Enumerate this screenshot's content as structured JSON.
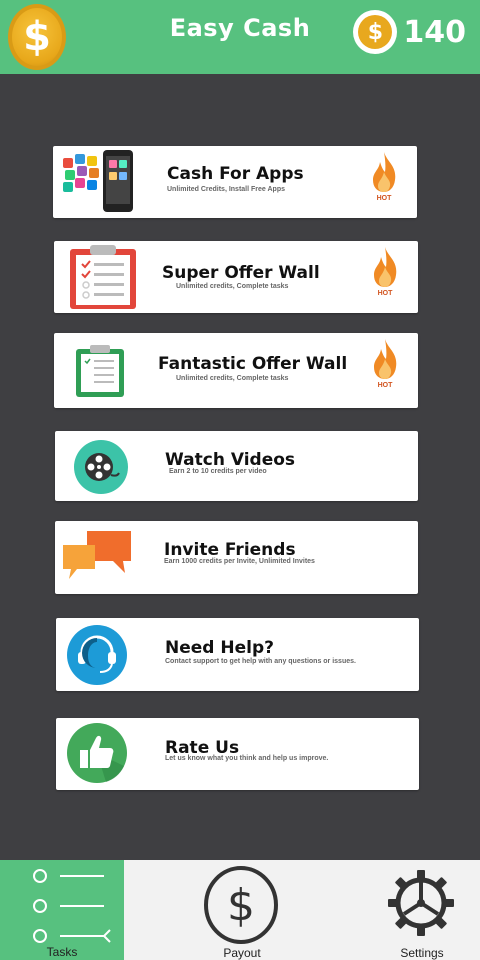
{
  "header": {
    "title": "Easy Cash",
    "balance": "140",
    "coin_symbol": "$"
  },
  "cards": [
    {
      "title": "Cash For Apps",
      "subtitle": "Unlimited Credits, Install Free Apps",
      "hot": "HOT"
    },
    {
      "title": "Super Offer Wall",
      "subtitle": "Unlimited credits, Complete tasks",
      "hot": "HOT"
    },
    {
      "title": "Fantastic Offer Wall",
      "subtitle": "Unlimited credits, Complete tasks",
      "hot": "HOT"
    },
    {
      "title": "Watch Videos",
      "subtitle": "Earn 2 to 10 credits per video"
    },
    {
      "title": "Invite Friends",
      "subtitle": "Earn 1000 credits per Invite, Unlimited Invites"
    },
    {
      "title": "Need Help?",
      "subtitle": "Contact support to get help with any questions or issues."
    },
    {
      "title": "Rate Us",
      "subtitle": "Let us know what you think and help us improve."
    }
  ],
  "nav": {
    "tasks": "Tasks",
    "payout": "Payout",
    "settings": "Settings"
  },
  "colors": {
    "brand_green": "#57c17f",
    "background": "#3f3f42",
    "coin": "#e8a81e"
  }
}
